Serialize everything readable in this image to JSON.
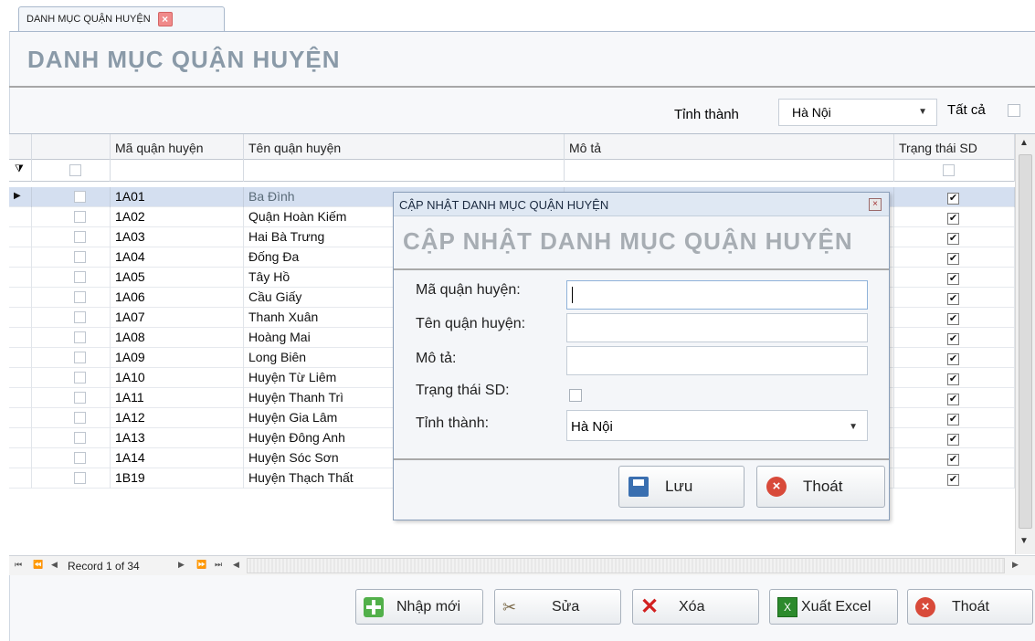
{
  "tab": {
    "label": "DANH MỤC QUẬN HUYỆN",
    "close": "×"
  },
  "page": {
    "title": "DANH MỤC QUẬN HUYỆN"
  },
  "filter": {
    "province_label": "Tỉnh thành",
    "province_value": "Hà Nội",
    "all_label": "Tất cả"
  },
  "grid": {
    "columns": [
      "Mã quận huyện",
      "Tên quận huyện",
      "Mô tả",
      "Trạng thái SD"
    ],
    "rows": [
      {
        "code": "1A01",
        "name": "Ba Đình"
      },
      {
        "code": "1A02",
        "name": "Quận Hoàn Kiếm"
      },
      {
        "code": "1A03",
        "name": "Hai Bà Trưng"
      },
      {
        "code": "1A04",
        "name": "Đống Đa"
      },
      {
        "code": "1A05",
        "name": "Tây Hồ"
      },
      {
        "code": "1A06",
        "name": "Cầu Giấy"
      },
      {
        "code": "1A07",
        "name": "Thanh Xuân"
      },
      {
        "code": "1A08",
        "name": "Hoàng Mai"
      },
      {
        "code": "1A09",
        "name": "Long Biên"
      },
      {
        "code": "1A10",
        "name": "Huyện Từ Liêm"
      },
      {
        "code": "1A11",
        "name": "Huyện Thanh Trì"
      },
      {
        "code": "1A12",
        "name": "Huyện Gia Lâm"
      },
      {
        "code": "1A13",
        "name": "Huyện Đông Anh"
      },
      {
        "code": "1A14",
        "name": "Huyện Sóc Sơn"
      },
      {
        "code": "1B19",
        "name": "Huyện Thạch Thất"
      }
    ],
    "check_mark": "✔",
    "navigator": "Record 1 of 34"
  },
  "toolbar": {
    "add": "Nhập mới",
    "edit": "Sửa",
    "delete": "Xóa",
    "export": "Xuất Excel",
    "exit": "Thoát"
  },
  "dialog": {
    "window_title": "CẬP NHẬT DANH MỤC QUẬN HUYỆN",
    "title": "CẬP NHẬT DANH MỤC QUẬN HUYỆN",
    "fields": {
      "code_label": "Mã quận huyện:",
      "name_label": "Tên quận huyện:",
      "desc_label": "Mô tả:",
      "status_label": "Trạng thái SD:",
      "province_label": "Tỉnh thành:",
      "province_value": "Hà Nội"
    },
    "save": "Lưu",
    "exit": "Thoát"
  },
  "colors": {
    "accent": "#d4dff0",
    "title_gray": "#8a9aa8"
  }
}
